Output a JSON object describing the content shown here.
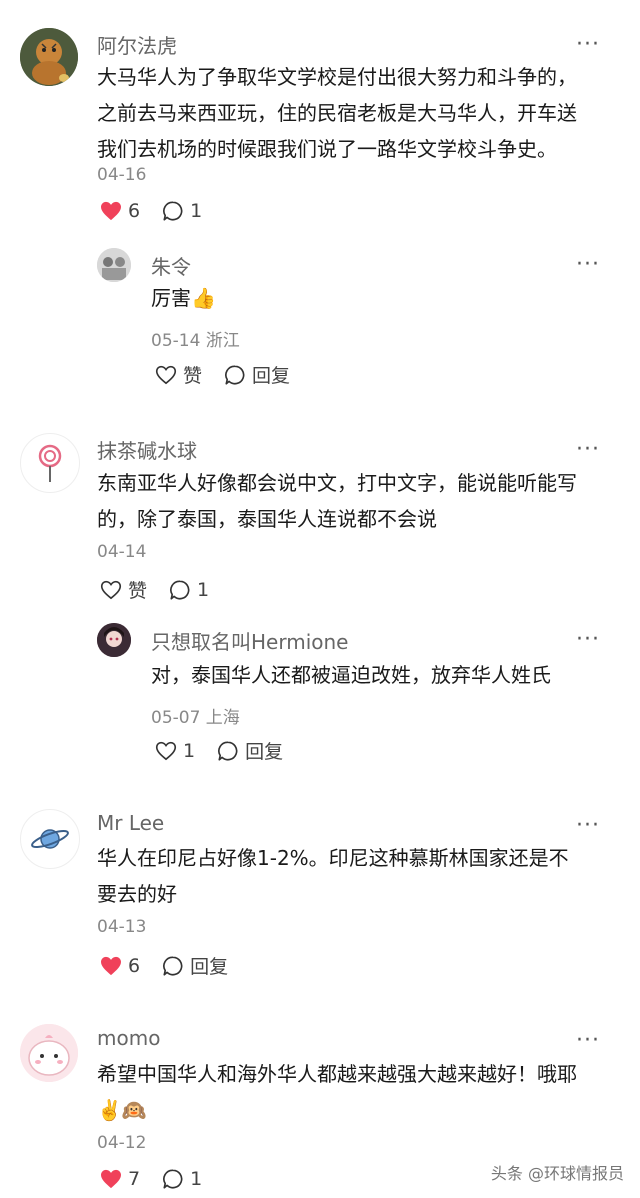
{
  "comments": [
    {
      "user": "阿尔法虎",
      "lines": [
        "大马华人为了争取华文学校是付出很大努力和斗争的，",
        "之前去马来西亚玩，住的民宿老板是大马华人，开车送",
        "我们去机场的时候跟我们说了一路华文学校斗争史。"
      ],
      "date": "04-16",
      "likes": "6",
      "replies": "1",
      "reply": {
        "user": "朱令",
        "text": "厉害👍",
        "date": "05-14 浙江",
        "like_label": "赞",
        "reply_label": "回复"
      }
    },
    {
      "user": "抹茶碱水球",
      "lines": [
        "东南亚华人好像都会说中文，打中文字，能说能听能写",
        "的，除了泰国，泰国华人连说都不会说"
      ],
      "date": "04-14",
      "like_label": "赞",
      "replies": "1",
      "reply": {
        "user": "只想取名叫Hermione",
        "text": "对，泰国华人还都被逼迫改姓，放弃华人姓氏",
        "date": "05-07 上海",
        "likes": "1",
        "reply_label": "回复"
      }
    },
    {
      "user": "Mr Lee",
      "lines": [
        "华人在印尼占好像1-2%。印尼这种慕斯林国家还是不",
        "要去的好"
      ],
      "date": "04-13",
      "likes": "6",
      "reply_label": "回复"
    },
    {
      "user": "momo",
      "lines": [
        "希望中国华人和海外华人都越来越强大越来越好！哦耶",
        "✌️🙉"
      ],
      "date": "04-12",
      "likes": "7",
      "replies": "1"
    }
  ],
  "more_label": "···",
  "watermark": "头条 @环球情报员",
  "colors": {
    "liked": "#f0415a",
    "icon": "#333333"
  }
}
